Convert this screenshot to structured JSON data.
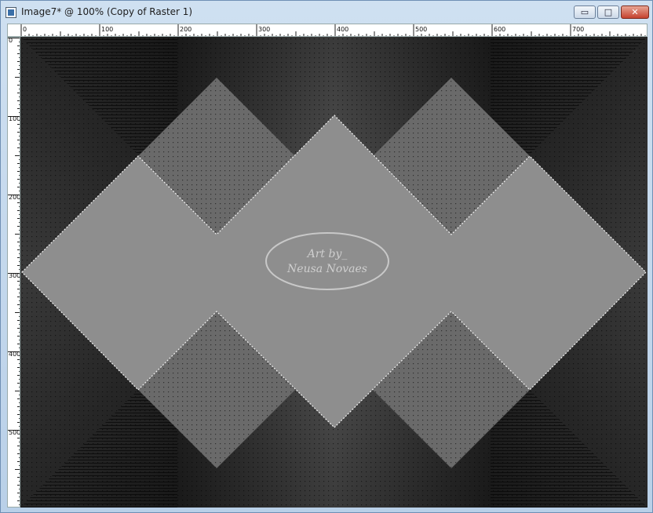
{
  "window": {
    "title": "Image7* @ 100% (Copy of Raster 1)",
    "buttons": {
      "minimize": "▭",
      "maximize": "□",
      "close": "✕"
    }
  },
  "ruler": {
    "horizontal_labels": [
      "0",
      "100",
      "200",
      "300",
      "400",
      "500",
      "600",
      "700"
    ],
    "vertical_labels": [
      "0",
      "100",
      "200",
      "300",
      "400",
      "500"
    ]
  },
  "watermark": {
    "line1": "Art by_",
    "line2": "Neusa Novaes"
  },
  "icons": {
    "app": "image-document-icon"
  },
  "colors": {
    "canvas_dark": "#2f2f2f",
    "shape_fill": "#8e8e8e",
    "shape_back": "#6a6a6a",
    "window_frame": "#bcd3ea"
  }
}
